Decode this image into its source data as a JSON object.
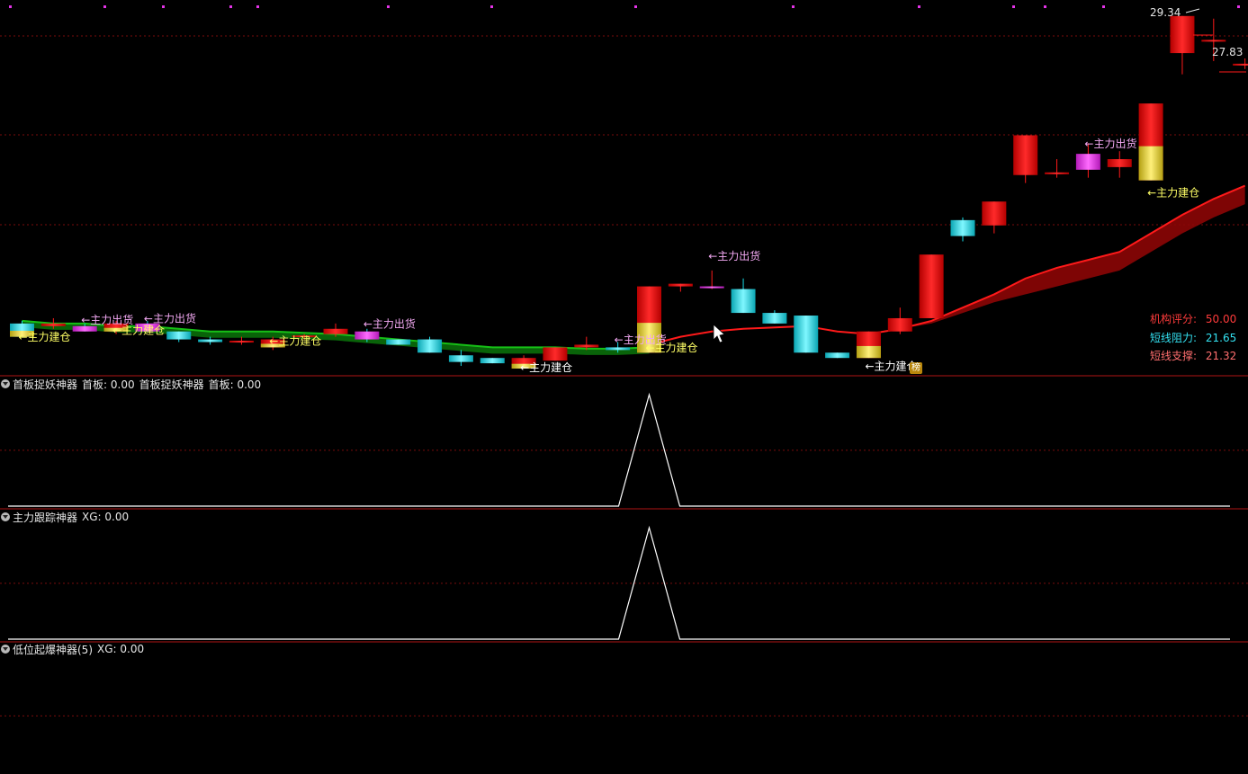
{
  "colors": {
    "bull": "#ff1a1a",
    "bear": "#16dbe6",
    "magenta": "#e433e8",
    "yellow": "#e8d232",
    "green": "#16c016",
    "band_red": "#8c0505",
    "grid": "#7a0c0c",
    "separator": "#b01515",
    "label_yellow": "#ffff66",
    "label_pink": "#f2a8f2",
    "label_white": "#ffffff"
  },
  "main": {
    "price_labels": {
      "high": "29.34",
      "last": "27.83"
    },
    "badge": "榜",
    "info": {
      "score_label": "机构评分:",
      "score_value": "50.00",
      "resist_label": "短线阻力:",
      "resist_value": "21.65",
      "support_label": "短线支撑:",
      "support_value": "21.32"
    }
  },
  "chart_data": [
    {
      "type": "candlestick",
      "ylim": [
        16.2,
        29.9
      ],
      "candles": [
        {
          "o": 17.9,
          "h": 18.0,
          "l": 17.5,
          "c": 17.4
        },
        {
          "o": 17.8,
          "h": 18.1,
          "l": 17.7,
          "c": 17.9
        },
        {
          "o": 17.8,
          "h": 17.9,
          "l": 17.6,
          "c": 17.6
        },
        {
          "o": 17.6,
          "h": 18.0,
          "l": 17.5,
          "c": 17.9
        },
        {
          "o": 17.9,
          "h": 18.0,
          "l": 17.6,
          "c": 17.6
        },
        {
          "o": 17.6,
          "h": 17.6,
          "l": 17.2,
          "c": 17.3
        },
        {
          "o": 17.3,
          "h": 17.4,
          "l": 17.1,
          "c": 17.2
        },
        {
          "o": 17.2,
          "h": 17.4,
          "l": 17.1,
          "c": 17.25
        },
        {
          "o": 17.0,
          "h": 17.4,
          "l": 16.9,
          "c": 17.3
        },
        {
          "o": 17.4,
          "h": 17.5,
          "l": 17.3,
          "c": 17.45
        },
        {
          "o": 17.5,
          "h": 17.9,
          "l": 17.4,
          "c": 17.7
        },
        {
          "o": 17.6,
          "h": 17.7,
          "l": 17.2,
          "c": 17.3
        },
        {
          "o": 17.3,
          "h": 17.3,
          "l": 17.1,
          "c": 17.1
        },
        {
          "o": 17.3,
          "h": 17.4,
          "l": 16.8,
          "c": 16.8
        },
        {
          "o": 16.7,
          "h": 16.9,
          "l": 16.3,
          "c": 16.45
        },
        {
          "o": 16.6,
          "h": 16.6,
          "l": 16.4,
          "c": 16.4
        },
        {
          "o": 16.2,
          "h": 16.7,
          "l": 16.2,
          "c": 16.6
        },
        {
          "o": 16.5,
          "h": 17.0,
          "l": 16.5,
          "c": 17.0
        },
        {
          "o": 17.0,
          "h": 17.4,
          "l": 16.9,
          "c": 17.1
        },
        {
          "o": 17.0,
          "h": 17.2,
          "l": 16.8,
          "c": 16.9
        },
        {
          "o": 16.8,
          "h": 19.3,
          "l": 16.8,
          "c": 19.3
        },
        {
          "o": 19.3,
          "h": 19.4,
          "l": 19.1,
          "c": 19.4
        },
        {
          "o": 19.3,
          "h": 19.9,
          "l": 19.2,
          "c": 19.3
        },
        {
          "o": 19.2,
          "h": 19.6,
          "l": 18.3,
          "c": 18.3
        },
        {
          "o": 18.3,
          "h": 18.4,
          "l": 17.9,
          "c": 17.9
        },
        {
          "o": 18.2,
          "h": 18.2,
          "l": 16.8,
          "c": 16.8
        },
        {
          "o": 16.8,
          "h": 16.8,
          "l": 16.6,
          "c": 16.6
        },
        {
          "o": 16.6,
          "h": 17.6,
          "l": 16.6,
          "c": 17.6
        },
        {
          "o": 17.6,
          "h": 18.5,
          "l": 17.5,
          "c": 18.1
        },
        {
          "o": 18.1,
          "h": 20.5,
          "l": 18.1,
          "c": 20.5
        },
        {
          "o": 21.8,
          "h": 21.9,
          "l": 21.0,
          "c": 21.2
        },
        {
          "o": 21.6,
          "h": 22.5,
          "l": 21.3,
          "c": 22.5
        },
        {
          "o": 23.5,
          "h": 24.5,
          "l": 23.2,
          "c": 25.0
        },
        {
          "o": 23.6,
          "h": 24.1,
          "l": 23.4,
          "c": 23.6
        },
        {
          "o": 23.7,
          "h": 24.7,
          "l": 23.4,
          "c": 24.3
        },
        {
          "o": 23.8,
          "h": 24.4,
          "l": 23.4,
          "c": 24.1
        },
        {
          "o": 23.3,
          "h": 26.2,
          "l": 23.3,
          "c": 26.2
        },
        {
          "o": 28.1,
          "h": 29.5,
          "l": 27.3,
          "c": 29.5
        },
        {
          "o": 28.6,
          "h": 29.4,
          "l": 27.8,
          "c": 28.6
        },
        {
          "o": 27.7,
          "h": 27.9,
          "l": 27.5,
          "c": 27.7
        }
      ],
      "green_line": [
        18.0,
        17.9,
        17.9,
        17.8,
        17.8,
        17.7,
        17.6,
        17.6,
        17.6,
        17.55,
        17.5,
        17.4,
        17.3,
        17.2,
        17.1,
        17.0,
        17.0,
        17.0,
        16.95,
        16.95,
        17.0,
        null,
        null,
        null,
        null,
        null,
        null,
        17.6
      ],
      "red_line": [
        null,
        null,
        null,
        null,
        null,
        null,
        null,
        null,
        null,
        null,
        null,
        null,
        null,
        null,
        null,
        null,
        null,
        null,
        null,
        null,
        17.1,
        17.4,
        17.6,
        17.7,
        17.75,
        17.8,
        17.6,
        17.5,
        17.7,
        18.0,
        18.5,
        19.0,
        19.6,
        20.0,
        20.3,
        20.6,
        21.3,
        22.0,
        22.6,
        23.1
      ],
      "red_band_lower": [
        null,
        null,
        null,
        null,
        null,
        null,
        null,
        null,
        null,
        null,
        null,
        null,
        null,
        null,
        null,
        null,
        null,
        null,
        null,
        null,
        null,
        null,
        null,
        null,
        null,
        null,
        null,
        null,
        17.7,
        17.9,
        18.3,
        18.7,
        19.0,
        19.3,
        19.6,
        19.9,
        20.6,
        21.3,
        21.9,
        22.4
      ],
      "signals": [
        {
          "text": "←主力建仓",
          "idx": 0,
          "price": 17.25,
          "color": "yellow"
        },
        {
          "text": "←主力出货",
          "idx": 2,
          "price": 17.9,
          "color": "pink"
        },
        {
          "text": "←主力出货",
          "idx": 4,
          "price": 17.95,
          "color": "pink"
        },
        {
          "text": "←主力建仓",
          "idx": 3,
          "price": 17.5,
          "color": "yellow"
        },
        {
          "text": "←主力建仓",
          "idx": 8,
          "price": 17.1,
          "color": "yellow"
        },
        {
          "text": "←主力出货",
          "idx": 11,
          "price": 17.75,
          "color": "pink"
        },
        {
          "text": "←主力建仓",
          "idx": 16,
          "price": 16.1,
          "color": "white"
        },
        {
          "text": "←主力出货",
          "idx": 19,
          "price": 17.15,
          "color": "pink"
        },
        {
          "text": "←主力建仓",
          "idx": 20,
          "price": 16.85,
          "color": "yellow"
        },
        {
          "text": "←主力出货",
          "idx": 22,
          "price": 20.3,
          "color": "pink"
        },
        {
          "text": "←主力建仓",
          "idx": 27,
          "price": 16.15,
          "color": "white"
        },
        {
          "text": "←主力出货",
          "idx": 34,
          "price": 24.55,
          "color": "pink"
        },
        {
          "text": "←主力建仓",
          "idx": 36,
          "price": 22.7,
          "color": "yellow"
        }
      ]
    },
    {
      "type": "line",
      "title": "首板捉妖神器",
      "legend": "首板: 0.00",
      "legend_prefix": "首板捉妖神器",
      "legend2": "首板: 0.00",
      "ylim": [
        0,
        1
      ],
      "values": [
        0,
        0,
        0,
        0,
        0,
        0,
        0,
        0,
        0,
        0,
        0,
        0,
        0,
        0,
        0,
        0,
        0,
        0,
        0,
        0,
        1,
        0,
        0,
        0,
        0,
        0,
        0,
        0,
        0,
        0,
        0,
        0,
        0,
        0,
        0,
        0,
        0,
        0,
        0,
        0
      ]
    },
    {
      "type": "line",
      "title": "主力跟踪神器",
      "legend": "XG: 0.00",
      "ylim": [
        0,
        1
      ],
      "values": [
        0,
        0,
        0,
        0,
        0,
        0,
        0,
        0,
        0,
        0,
        0,
        0,
        0,
        0,
        0,
        0,
        0,
        0,
        0,
        0,
        1,
        0,
        0,
        0,
        0,
        0,
        0,
        0,
        0,
        0,
        0,
        0,
        0,
        0,
        0,
        0,
        0,
        0,
        0,
        0
      ]
    },
    {
      "type": "line",
      "title": "低位起爆神器(5)",
      "legend": "XG: 0.00",
      "ylim": [
        0,
        1
      ],
      "values": []
    }
  ]
}
